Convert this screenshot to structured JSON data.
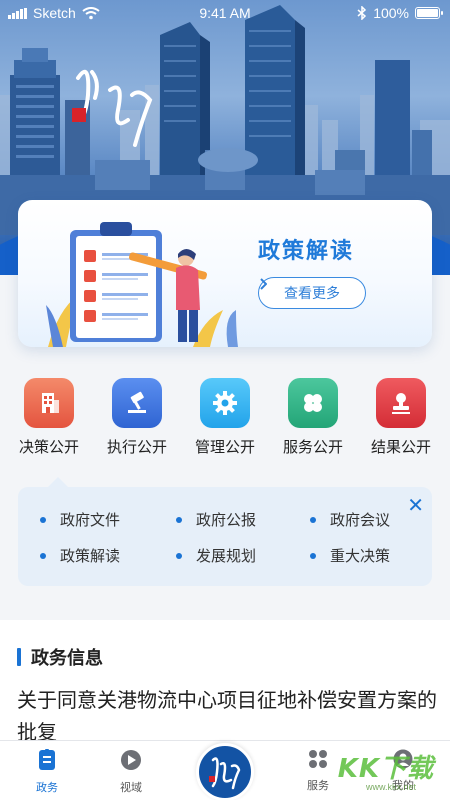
{
  "status_bar": {
    "carrier": "Sketch",
    "time": "9:41 AM",
    "battery": "100%",
    "battery_level": 1.0
  },
  "banner": {
    "title": "政策解读",
    "button_label": "查看更多"
  },
  "categories": [
    {
      "label": "决策公开",
      "icon": "building-icon",
      "color": "#e8604f"
    },
    {
      "label": "执行公开",
      "icon": "gavel-icon",
      "color": "#3b74dd"
    },
    {
      "label": "管理公开",
      "icon": "gear-icon",
      "color": "#33b4f0"
    },
    {
      "label": "服务公开",
      "icon": "clover-icon",
      "color": "#2fb58a"
    },
    {
      "label": "结果公开",
      "icon": "stamp-icon",
      "color": "#e03e45"
    }
  ],
  "sub_menu": {
    "items": [
      "政府文件",
      "政府公报",
      "政府会议",
      "政策解读",
      "发展规划",
      "重大决策"
    ],
    "close_icon": "close-icon"
  },
  "news": {
    "section_title": "政务信息",
    "headline": "关于同意关港物流中心项目征地补偿安置方案的批复"
  },
  "tabbar": {
    "tabs": [
      {
        "label": "政务",
        "icon": "document-icon",
        "active": true
      },
      {
        "label": "视域",
        "icon": "play-icon",
        "active": false
      },
      {
        "label": "服务",
        "icon": "grid-icon",
        "active": false
      },
      {
        "label": "我的",
        "icon": "user-icon",
        "active": false
      }
    ]
  },
  "watermark": {
    "text": "KK下载",
    "url": "www.kkx.net"
  },
  "colors": {
    "primary": "#1a73d4",
    "hero_dark": "#1560c9"
  }
}
